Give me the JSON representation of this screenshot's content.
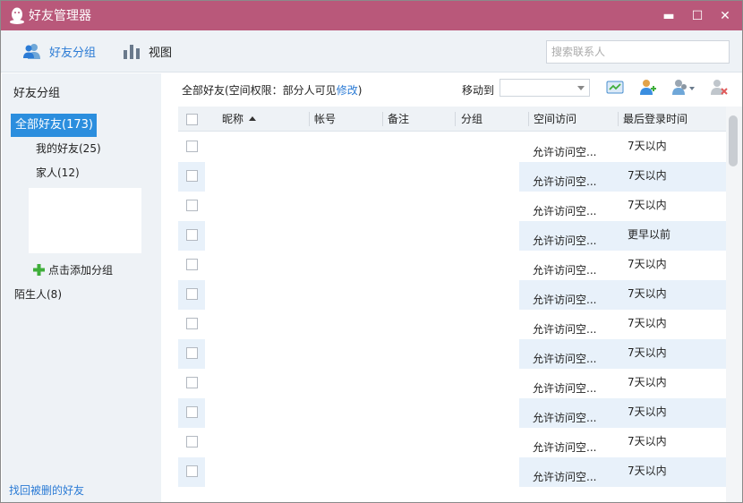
{
  "window": {
    "title": "好友管理器",
    "minimize_glyph": "▬",
    "maximize_glyph": "☐",
    "close_glyph": "✕"
  },
  "toolbar": {
    "groups_label": "好友分组",
    "view_label": "视图",
    "search_placeholder": "搜索联系人"
  },
  "sidebar": {
    "header": "好友分组",
    "all_friends": "全部好友(173)",
    "groups": [
      {
        "label": "我的好友(25)"
      },
      {
        "label": "家人(12)"
      }
    ],
    "add_group": "点击添加分组",
    "strangers": "陌生人(8)",
    "recover_link": "找回被删的好友"
  },
  "content": {
    "permission_prefix": "全部好友(空间权限：部分人可见",
    "permission_link": "修改",
    "permission_suffix": ")",
    "move_to_label": "移动到",
    "move_to_value": ""
  },
  "table": {
    "columns": {
      "nickname": "昵称",
      "account": "帐号",
      "remark": "备注",
      "group": "分组",
      "space_access": "空间访问",
      "last_login": "最后登录时间"
    },
    "rows": [
      {
        "space_access": "允许访问空...",
        "last_login": "7天以内"
      },
      {
        "space_access": "允许访问空...",
        "last_login": "7天以内"
      },
      {
        "space_access": "允许访问空...",
        "last_login": "7天以内"
      },
      {
        "space_access": "允许访问空...",
        "last_login": "更早以前"
      },
      {
        "space_access": "允许访问空...",
        "last_login": "7天以内"
      },
      {
        "space_access": "允许访问空...",
        "last_login": "7天以内"
      },
      {
        "space_access": "允许访问空...",
        "last_login": "7天以内"
      },
      {
        "space_access": "允许访问空...",
        "last_login": "7天以内"
      },
      {
        "space_access": "允许访问空...",
        "last_login": "7天以内"
      },
      {
        "space_access": "允许访问空...",
        "last_login": "7天以内"
      },
      {
        "space_access": "允许访问空...",
        "last_login": "7天以内"
      },
      {
        "space_access": "允许访问空...",
        "last_login": "7天以内"
      }
    ]
  },
  "colors": {
    "titlebar": "#b9587a",
    "selection": "#2b8ede",
    "link": "#2b7bd5",
    "panel": "#eef2f6",
    "row_alt": "#e8f1fa"
  }
}
